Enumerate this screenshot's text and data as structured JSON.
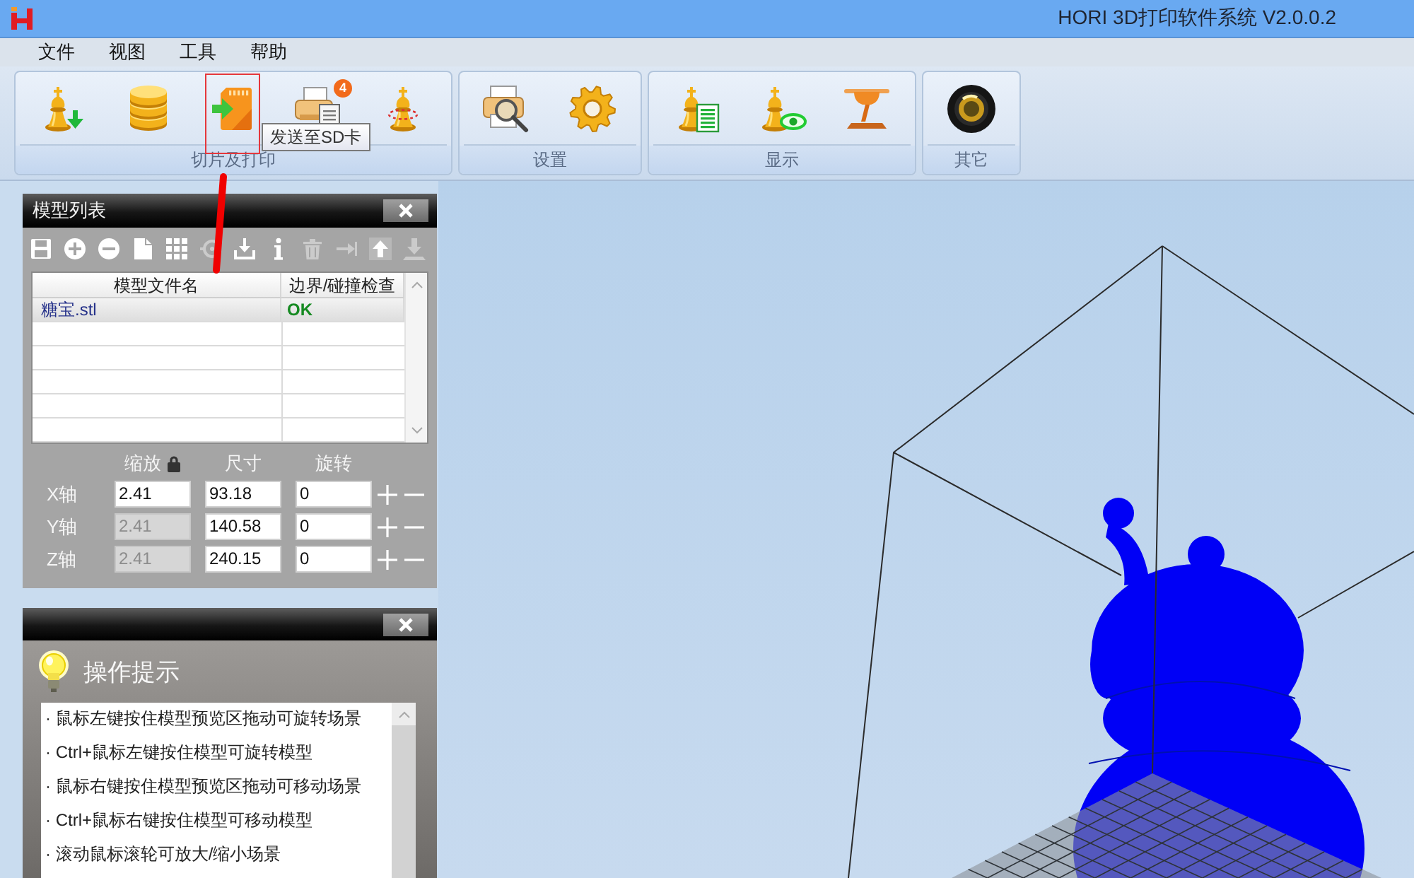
{
  "window": {
    "title": "HORI 3D打印软件系统 V2.0.0.2"
  },
  "menu": [
    "文件",
    "视图",
    "工具",
    "帮助"
  ],
  "toolbar": {
    "groups": [
      {
        "label": "切片及打印",
        "buttons": [
          {
            "kind": "import"
          },
          {
            "kind": "stack"
          },
          {
            "kind": "card",
            "tooltip": "发送至SD卡"
          },
          {
            "kind": "printer",
            "badge": "4"
          },
          {
            "kind": "piece"
          }
        ]
      },
      {
        "label": "设置",
        "buttons": [
          {
            "kind": "preview"
          },
          {
            "kind": "gear"
          }
        ]
      },
      {
        "label": "显示",
        "buttons": [
          {
            "kind": "report"
          },
          {
            "kind": "view"
          },
          {
            "kind": "nozzle"
          }
        ]
      },
      {
        "label": "其它",
        "buttons": [
          {
            "kind": "camera"
          }
        ]
      }
    ]
  },
  "model_list": {
    "title": "模型列表",
    "tools": [
      {
        "kind": "save",
        "disabled": false
      },
      {
        "kind": "add",
        "disabled": false
      },
      {
        "kind": "remove",
        "disabled": false
      },
      {
        "kind": "copy",
        "disabled": false
      },
      {
        "kind": "grid",
        "disabled": false
      },
      {
        "kind": "ring",
        "disabled": true
      },
      {
        "kind": "import",
        "disabled": false
      },
      {
        "kind": "info",
        "disabled": false
      },
      {
        "kind": "trash",
        "disabled": true
      },
      {
        "kind": "right",
        "disabled": true
      },
      {
        "kind": "up",
        "disabled": false
      },
      {
        "kind": "down",
        "disabled": true
      }
    ],
    "columns": [
      "模型文件名",
      "边界/碰撞检查"
    ],
    "rows": [
      {
        "file": "糖宝.stl",
        "check": "OK",
        "selected": true
      }
    ],
    "transform": {
      "columns": [
        {
          "label": "缩放",
          "locked": true
        },
        {
          "label": "尺寸",
          "locked": false
        },
        {
          "label": "旋转",
          "locked": false
        }
      ],
      "rows": [
        {
          "axis": "X轴",
          "scale": "2.41",
          "scale_disabled": false,
          "size": "93.18",
          "rotation": "0"
        },
        {
          "axis": "Y轴",
          "scale": "2.41",
          "scale_disabled": true,
          "size": "140.58",
          "rotation": "0"
        },
        {
          "axis": "Z轴",
          "scale": "2.41",
          "scale_disabled": true,
          "size": "240.15",
          "rotation": "0"
        }
      ]
    }
  },
  "tips": {
    "title": "操作提示",
    "items": [
      "· 鼠标左键按住模型预览区拖动可旋转场景",
      "· Ctrl+鼠标左键按住模型可旋转模型",
      "· 鼠标右键按住模型预览区拖动可移动场景",
      "· Ctrl+鼠标右键按住模型可移动模型",
      "· 滚动鼠标滚轮可放大/缩小场景"
    ]
  }
}
